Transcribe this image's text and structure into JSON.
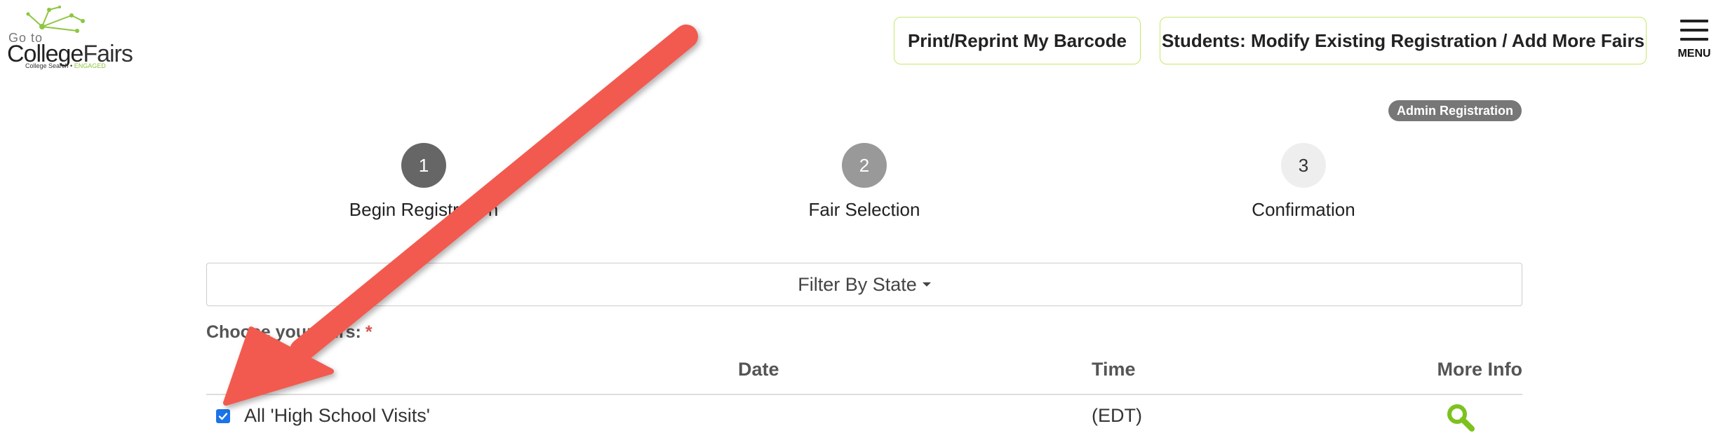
{
  "logo": {
    "go_text": "Go to",
    "brand_part1": "College",
    "brand_part2": "Fairs",
    "tagline_part1": "College Search • ",
    "tagline_part2": "ENGAGED",
    "accent_color": "#8dc63f"
  },
  "header": {
    "barcode_button": "Print/Reprint My Barcode",
    "modify_button": "Students: Modify Existing Registration / Add More Fairs",
    "menu_label": "MENU",
    "menu_icon": "hamburger-icon",
    "button_border_color": "#c5e86c"
  },
  "badge": "Admin Registration",
  "steps": [
    {
      "number": "1",
      "label": "Begin Registration"
    },
    {
      "number": "2",
      "label": "Fair Selection"
    },
    {
      "number": "3",
      "label": "Confirmation"
    }
  ],
  "filter": {
    "label": "Filter By State"
  },
  "choose_label": "Choose your fairs:",
  "required_mark": "*",
  "table": {
    "headers": [
      "Name",
      "Date",
      "Time",
      "More Info"
    ],
    "rows": [
      {
        "checked": true,
        "name": "All 'High School Visits'",
        "date": "",
        "time": "(EDT)",
        "info_icon": "search-icon"
      }
    ]
  },
  "annotation": {
    "type": "arrow",
    "color": "#f25a50"
  }
}
